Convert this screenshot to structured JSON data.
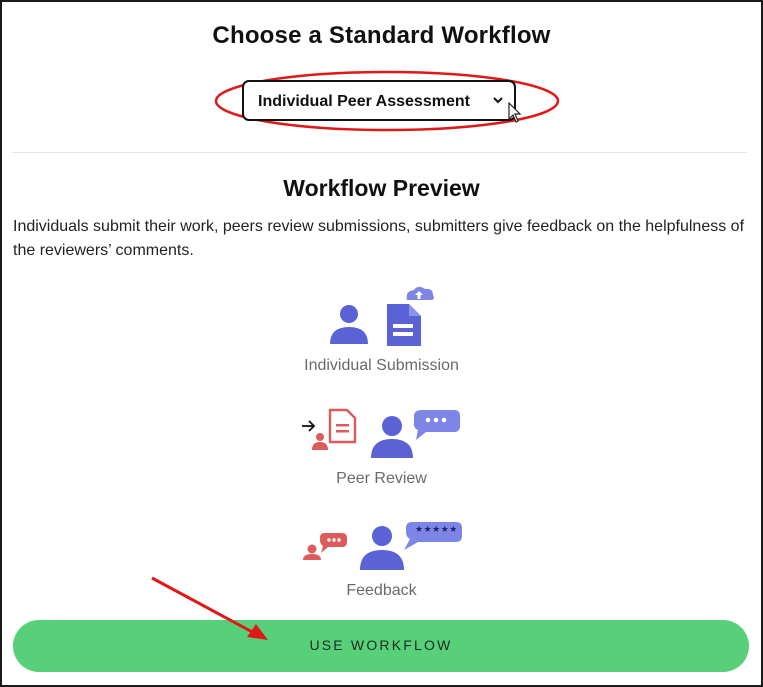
{
  "header": {
    "title": "Choose a Standard Workflow"
  },
  "workflow_select": {
    "selected": "Individual Peer Assessment"
  },
  "preview": {
    "title": "Workflow Preview",
    "description": "Individuals submit their work, peers review submissions, submitters give feedback on the helpfulness of the reviewers’ comments.",
    "steps": [
      {
        "label": "Individual Submission",
        "icon": "individual-submission-icon"
      },
      {
        "label": "Peer Review",
        "icon": "peer-review-icon"
      },
      {
        "label": "Feedback",
        "icon": "feedback-icon"
      }
    ],
    "feedback_bubble_rating": "★★★★★"
  },
  "actions": {
    "use_workflow": "USE WORKFLOW"
  },
  "colors": {
    "accent_blue": "#5a62d6",
    "accent_light_blue": "#7d86e6",
    "accent_red": "#df5b5b",
    "button_green": "#58cf79",
    "annotation_red": "#e01818"
  }
}
